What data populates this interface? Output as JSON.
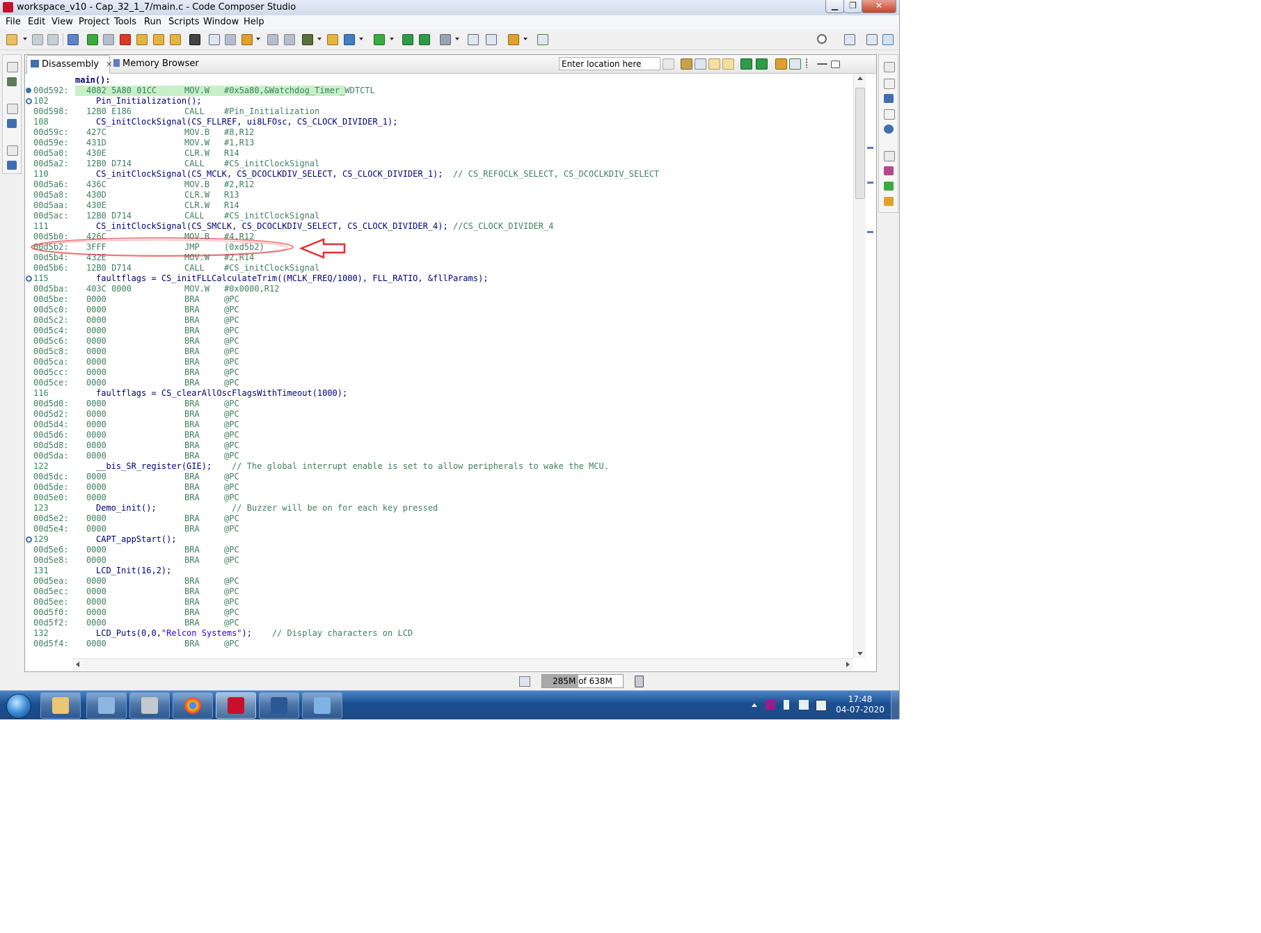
{
  "window": {
    "title": "workspace_v10 - Cap_32_1_7/main.c - Code Composer Studio",
    "min_glyph": "▁",
    "max_glyph": "❐",
    "close_glyph": "✕"
  },
  "menu": [
    "File",
    "Edit",
    "View",
    "Project",
    "Tools",
    "Run",
    "Scripts",
    "Window",
    "Help"
  ],
  "tabs": {
    "disassembly": "Disassembly",
    "close_glyph": "✕",
    "memory": "Memory Browser"
  },
  "location": {
    "value": "Enter location here"
  },
  "code": {
    "function": "main():",
    "lines": [
      {
        "t": "asm",
        "mark": "arrow",
        "addr": "00d592:",
        "op": "4082 5A80 01CC",
        "mn": "MOV.W",
        "oper": "#0x5a80,&Watchdog_Timer_WDTCTL"
      },
      {
        "t": "src",
        "mark": "bp",
        "num": "102",
        "text": "Pin_Initialization();"
      },
      {
        "t": "asm",
        "addr": "00d598:",
        "op": "12B0 E186",
        "mn": "CALL",
        "oper": "#Pin_Initialization"
      },
      {
        "t": "src",
        "num": "108",
        "text": "CS_initClockSignal(CS_FLLREF, ui8LFOsc, CS_CLOCK_DIVIDER_1);"
      },
      {
        "t": "asm",
        "addr": "00d59c:",
        "op": "427C",
        "mn": "MOV.B",
        "oper": "#8,R12"
      },
      {
        "t": "asm",
        "addr": "00d59e:",
        "op": "431D",
        "mn": "MOV.W",
        "oper": "#1,R13"
      },
      {
        "t": "asm",
        "addr": "00d5a0:",
        "op": "430E",
        "mn": "CLR.W",
        "oper": "R14"
      },
      {
        "t": "asm",
        "addr": "00d5a2:",
        "op": "12B0 D714",
        "mn": "CALL",
        "oper": "#CS_initClockSignal"
      },
      {
        "t": "src",
        "num": "110",
        "text": "CS_initClockSignal(CS_MCLK, CS_DCOCLKDIV_SELECT, CS_CLOCK_DIVIDER_1);",
        "comment": "  // CS_REFOCLK_SELECT, CS_DCOCLKDIV_SELECT"
      },
      {
        "t": "asm",
        "addr": "00d5a6:",
        "op": "436C",
        "mn": "MOV.B",
        "oper": "#2,R12"
      },
      {
        "t": "asm",
        "addr": "00d5a8:",
        "op": "430D",
        "mn": "CLR.W",
        "oper": "R13"
      },
      {
        "t": "asm",
        "addr": "00d5aa:",
        "op": "430E",
        "mn": "CLR.W",
        "oper": "R14"
      },
      {
        "t": "asm",
        "addr": "00d5ac:",
        "op": "12B0 D714",
        "mn": "CALL",
        "oper": "#CS_initClockSignal"
      },
      {
        "t": "src",
        "num": "111",
        "text": "CS_initClockSignal(CS_SMCLK, CS_DCOCLKDIV_SELECT, CS_CLOCK_DIVIDER_4);",
        "comment": " //CS_CLOCK_DIVIDER_4"
      },
      {
        "t": "asm",
        "addr": "00d5b0:",
        "op": "426C",
        "mn": "MOV.B",
        "oper": "#4,R12"
      },
      {
        "t": "asm",
        "addr": "00d5b2:",
        "op": "3FFF",
        "mn": "JMP",
        "oper": "(0xd5b2)"
      },
      {
        "t": "asm",
        "addr": "00d5b4:",
        "op": "432E",
        "mn": "MOV.W",
        "oper": "#2,R14"
      },
      {
        "t": "asm",
        "addr": "00d5b6:",
        "op": "12B0 D714",
        "mn": "CALL",
        "oper": "#CS_initClockSignal"
      },
      {
        "t": "src",
        "mark": "bp",
        "num": "115",
        "text": "faultflags = CS_initFLLCalculateTrim((MCLK_FREQ/1000), FLL_RATIO, &fllParams);"
      },
      {
        "t": "asm",
        "addr": "00d5ba:",
        "op": "403C 0000",
        "mn": "MOV.W",
        "oper": "#0x0000,R12"
      },
      {
        "t": "asm",
        "addr": "00d5be:",
        "op": "0000",
        "mn": "BRA",
        "oper": "@PC"
      },
      {
        "t": "asm",
        "addr": "00d5c0:",
        "op": "0000",
        "mn": "BRA",
        "oper": "@PC"
      },
      {
        "t": "asm",
        "addr": "00d5c2:",
        "op": "0000",
        "mn": "BRA",
        "oper": "@PC"
      },
      {
        "t": "asm",
        "addr": "00d5c4:",
        "op": "0000",
        "mn": "BRA",
        "oper": "@PC"
      },
      {
        "t": "asm",
        "addr": "00d5c6:",
        "op": "0000",
        "mn": "BRA",
        "oper": "@PC"
      },
      {
        "t": "asm",
        "addr": "00d5c8:",
        "op": "0000",
        "mn": "BRA",
        "oper": "@PC"
      },
      {
        "t": "asm",
        "addr": "00d5ca:",
        "op": "0000",
        "mn": "BRA",
        "oper": "@PC"
      },
      {
        "t": "asm",
        "addr": "00d5cc:",
        "op": "0000",
        "mn": "BRA",
        "oper": "@PC"
      },
      {
        "t": "asm",
        "addr": "00d5ce:",
        "op": "0000",
        "mn": "BRA",
        "oper": "@PC"
      },
      {
        "t": "src",
        "num": "116",
        "text": "faultflags = CS_clearAllOscFlagsWithTimeout(1000);"
      },
      {
        "t": "asm",
        "addr": "00d5d0:",
        "op": "0000",
        "mn": "BRA",
        "oper": "@PC"
      },
      {
        "t": "asm",
        "addr": "00d5d2:",
        "op": "0000",
        "mn": "BRA",
        "oper": "@PC"
      },
      {
        "t": "asm",
        "addr": "00d5d4:",
        "op": "0000",
        "mn": "BRA",
        "oper": "@PC"
      },
      {
        "t": "asm",
        "addr": "00d5d6:",
        "op": "0000",
        "mn": "BRA",
        "oper": "@PC"
      },
      {
        "t": "asm",
        "addr": "00d5d8:",
        "op": "0000",
        "mn": "BRA",
        "oper": "@PC"
      },
      {
        "t": "asm",
        "addr": "00d5da:",
        "op": "0000",
        "mn": "BRA",
        "oper": "@PC"
      },
      {
        "t": "src",
        "num": "122",
        "text": "__bis_SR_register(GIE);",
        "comment": "    // The global interrupt enable is set to allow peripherals to wake the MCU."
      },
      {
        "t": "asm",
        "addr": "00d5dc:",
        "op": "0000",
        "mn": "BRA",
        "oper": "@PC"
      },
      {
        "t": "asm",
        "addr": "00d5de:",
        "op": "0000",
        "mn": "BRA",
        "oper": "@PC"
      },
      {
        "t": "asm",
        "addr": "00d5e0:",
        "op": "0000",
        "mn": "BRA",
        "oper": "@PC"
      },
      {
        "t": "src",
        "num": "123",
        "text": "Demo_init();",
        "comment": "               // Buzzer will be on for each key pressed"
      },
      {
        "t": "asm",
        "addr": "00d5e2:",
        "op": "0000",
        "mn": "BRA",
        "oper": "@PC"
      },
      {
        "t": "asm",
        "addr": "00d5e4:",
        "op": "0000",
        "mn": "BRA",
        "oper": "@PC"
      },
      {
        "t": "src",
        "mark": "bp",
        "num": "129",
        "text": "CAPT_appStart();"
      },
      {
        "t": "asm",
        "addr": "00d5e6:",
        "op": "0000",
        "mn": "BRA",
        "oper": "@PC"
      },
      {
        "t": "asm",
        "addr": "00d5e8:",
        "op": "0000",
        "mn": "BRA",
        "oper": "@PC"
      },
      {
        "t": "src",
        "num": "131",
        "text": "LCD_Init(16,2);"
      },
      {
        "t": "asm",
        "addr": "00d5ea:",
        "op": "0000",
        "mn": "BRA",
        "oper": "@PC"
      },
      {
        "t": "asm",
        "addr": "00d5ec:",
        "op": "0000",
        "mn": "BRA",
        "oper": "@PC"
      },
      {
        "t": "asm",
        "addr": "00d5ee:",
        "op": "0000",
        "mn": "BRA",
        "oper": "@PC"
      },
      {
        "t": "asm",
        "addr": "00d5f0:",
        "op": "0000",
        "mn": "BRA",
        "oper": "@PC"
      },
      {
        "t": "asm",
        "addr": "00d5f2:",
        "op": "0000",
        "mn": "BRA",
        "oper": "@PC"
      },
      {
        "t": "src",
        "num": "132",
        "text": "LCD_Puts(0,0,",
        "string": "\"Relcon Systems\"",
        "after": ");",
        "comment": "    // Display characters on LCD"
      },
      {
        "t": "asm",
        "addr": "00d5f4:",
        "op": "0000",
        "mn": "BRA",
        "oper": "@PC"
      }
    ]
  },
  "status": {
    "heap_text": "285M of 638M",
    "heap_used_fraction": 0.447
  },
  "taskbar": {
    "clock_time": "17:48",
    "clock_date": "04-07-2020"
  },
  "colors": {
    "accent_red": "#c8102e",
    "annotation_red": "#e23030",
    "highlight_green": "#c8f0c8"
  }
}
